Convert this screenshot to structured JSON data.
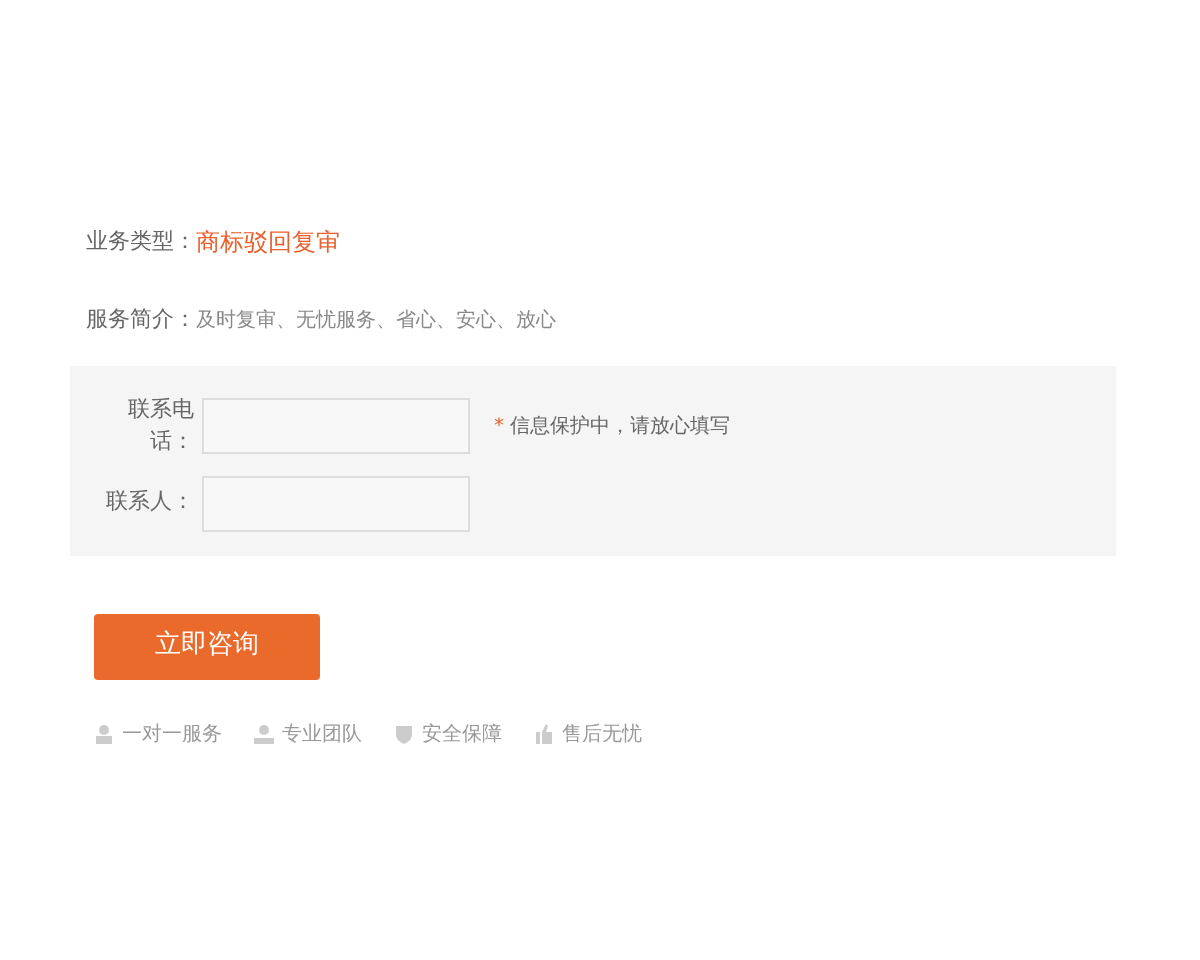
{
  "service_type": {
    "label": "业务类型：",
    "value": "商标驳回复审"
  },
  "service_intro": {
    "label": "服务简介：",
    "value": "及时复审、无忧服务、省心、安心、放心"
  },
  "form": {
    "fields": [
      {
        "label": "联系电话：",
        "hint": "* 信息保护中，请放心填写"
      },
      {
        "label": "联系人："
      }
    ]
  },
  "submit_button": "立即咨询",
  "features": [
    {
      "kind": "person",
      "label": "一对一服务"
    },
    {
      "kind": "team",
      "label": "专业团队"
    },
    {
      "kind": "shield",
      "label": "安全保障"
    },
    {
      "kind": "thumb",
      "label": "售后无忧"
    }
  ]
}
